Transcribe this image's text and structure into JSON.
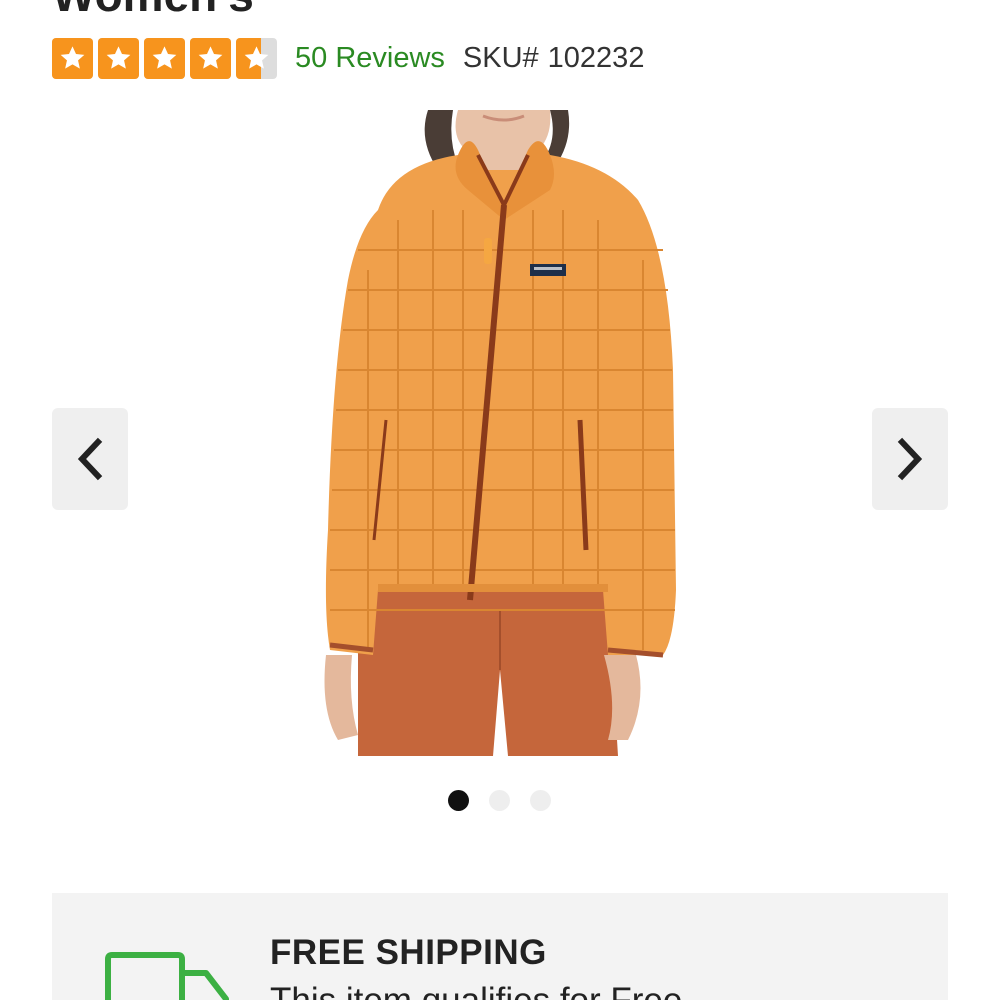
{
  "product": {
    "title": "Women's",
    "rating": {
      "stars_filled": [
        1,
        1,
        1,
        1,
        0.6
      ],
      "star_color": "#f7941d"
    },
    "reviews_label": "50 Reviews",
    "sku_label": "SKU#",
    "sku_value": "102232"
  },
  "gallery": {
    "prev_icon": "chevron-left-icon",
    "next_icon": "chevron-right-icon",
    "dots": [
      {
        "active": true
      },
      {
        "active": false
      },
      {
        "active": false
      }
    ]
  },
  "shipping": {
    "title": "FREE SHIPPING",
    "description": "This item qualifies for Free",
    "icon": "truck-icon",
    "icon_color": "#3cb043"
  },
  "colors": {
    "accent_green": "#2a8a22",
    "star_orange": "#f7941d",
    "jacket_orange": "#f0a04b",
    "zipper_brown": "#8a3a1a"
  }
}
